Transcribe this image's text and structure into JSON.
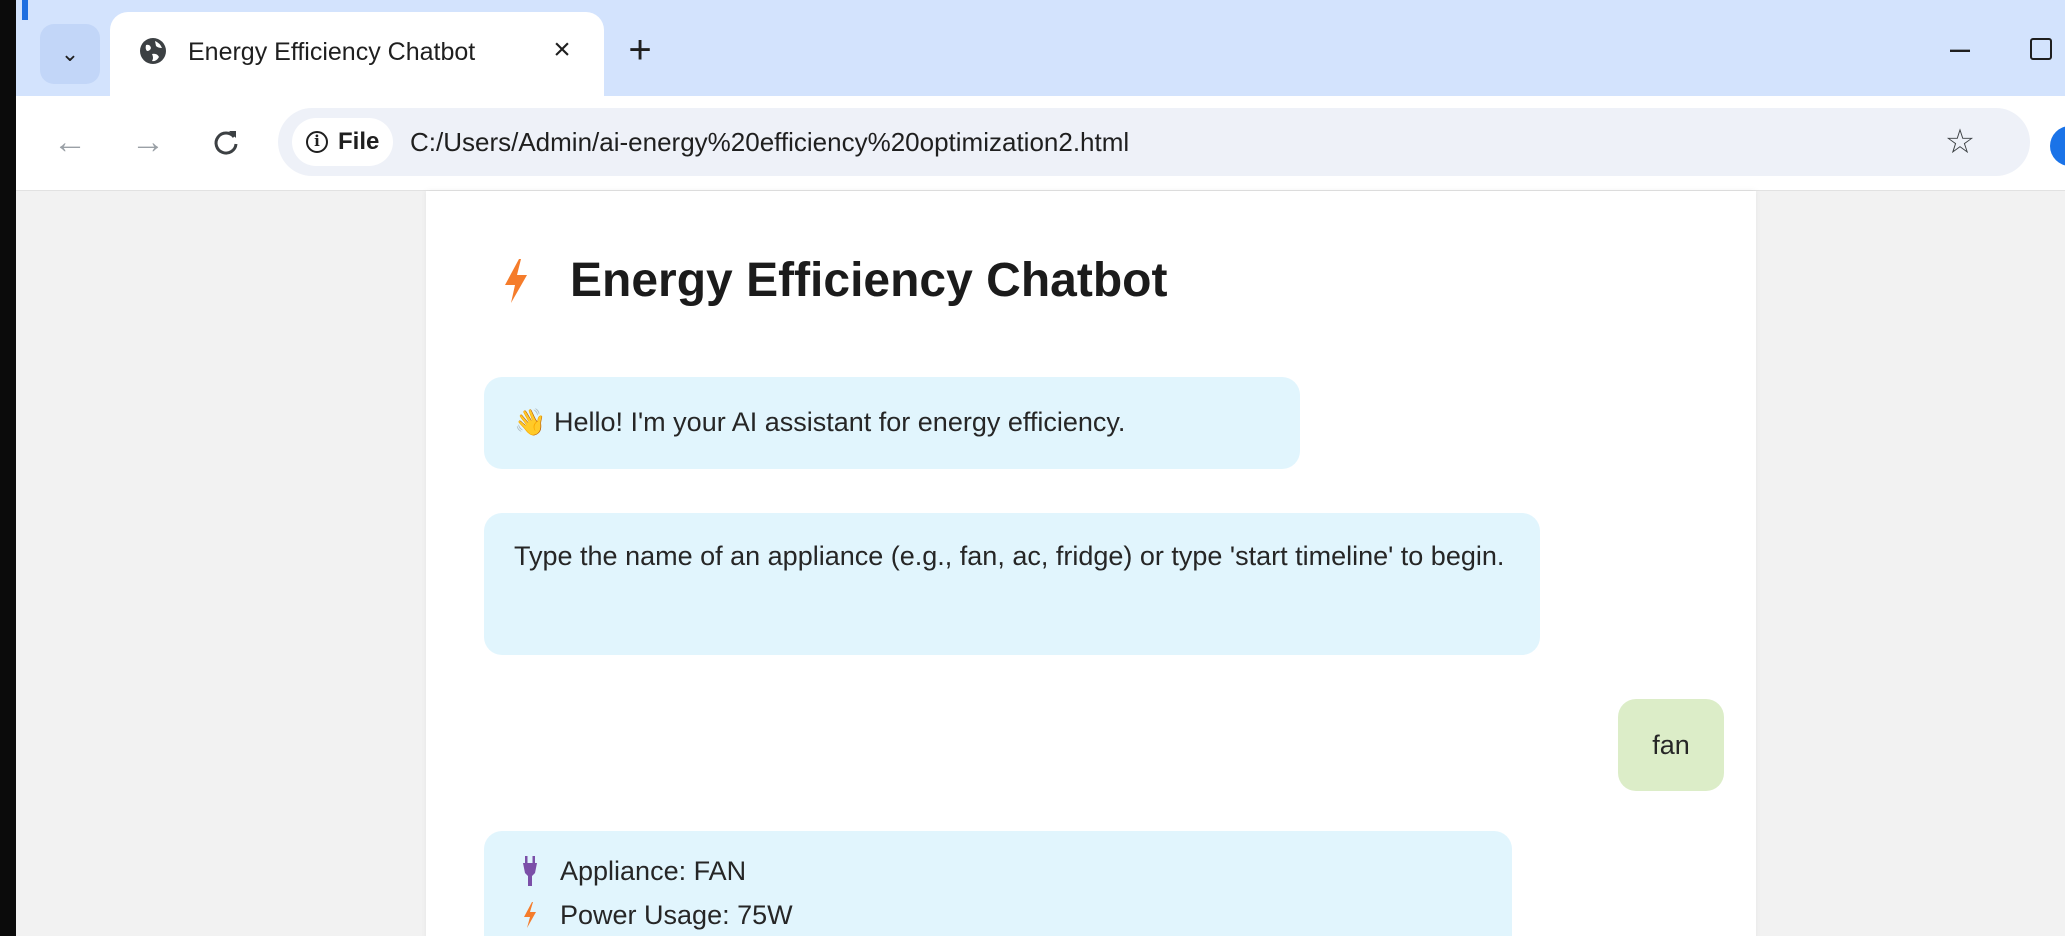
{
  "browser": {
    "tab_title": "Energy Efficiency Chatbot",
    "tab_close": "×",
    "new_tab": "+",
    "minimize": "–",
    "back": "←",
    "forward": "→",
    "reload": "C",
    "chip_label": "File",
    "url": "C:/Users/Admin/ai-energy%20efficiency%20optimization2.html",
    "bookmark_star": "☆",
    "tab_search": "⌄"
  },
  "chat": {
    "title": "Energy Efficiency Chatbot",
    "messages": [
      {
        "from": "bot",
        "text": "Hello! I'm your AI assistant for energy efficiency.",
        "emoji": "👋"
      },
      {
        "from": "bot",
        "text": "Type the name of an appliance (e.g., fan, ac, fridge) or type 'start timeline' to begin."
      },
      {
        "from": "user",
        "text": "fan"
      },
      {
        "from": "bot",
        "lines": [
          "Appliance: FAN",
          "Power Usage: 75W"
        ]
      }
    ]
  },
  "colors": {
    "tab_strip": "#d3e3fd",
    "bot_bubble": "#e1f5fd",
    "user_bubble": "#dcedc8",
    "bolt": "#f57c2b",
    "plug": "#7b4fa8"
  }
}
